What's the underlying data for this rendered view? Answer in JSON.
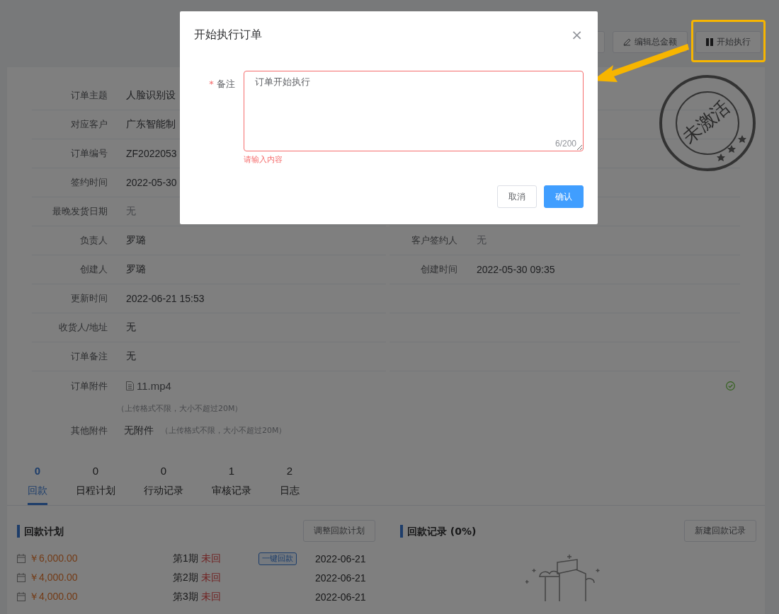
{
  "toolbar": {
    "buttons": [
      {
        "kind": "hidden"
      },
      {
        "kind": "edit",
        "label": "编辑总金额"
      },
      {
        "kind": "start",
        "label": "开始执行"
      }
    ]
  },
  "stamp": "未激活",
  "details": [
    {
      "label": "订单主题",
      "value": "人脸识别设",
      "muted": false
    },
    {
      "label": "对应客户",
      "value": "广东智能制",
      "muted": false
    },
    {
      "label": "订单编号",
      "value": "ZF2022053",
      "muted": false
    },
    {
      "label": "签约时间",
      "value": "2022-05-30",
      "muted": false
    },
    {
      "label": "最晚发货日期",
      "value": "无",
      "muted": true
    },
    {
      "label": "负责人",
      "value": "罗璐",
      "muted": false
    },
    {
      "label": "创建人",
      "value": "罗璐",
      "muted": false
    },
    {
      "label": "更新时间",
      "value": "2022-06-21 15:53",
      "muted": false
    },
    {
      "label": "收货人/地址",
      "value": "无",
      "muted": false
    },
    {
      "label": "订单备注",
      "value": "无",
      "muted": false
    }
  ],
  "right_details": [
    {
      "label": "客户签约人",
      "value": "无",
      "muted": true
    },
    {
      "label": "创建时间",
      "value": "2022-05-30 09:35",
      "muted": false
    }
  ],
  "attachment": {
    "label": "订单附件",
    "file": "11.mp4",
    "uploaded": true,
    "hint": "（上传格式不限，大小不超过20M）"
  },
  "other_attachment": {
    "label": "其他附件",
    "value": "无附件",
    "hint": "（上传格式不限，大小不超过20M）"
  },
  "tabs": [
    {
      "count": "0",
      "label": "回款",
      "selected": true
    },
    {
      "count": "0",
      "label": "日程计划",
      "selected": false
    },
    {
      "count": "0",
      "label": "行动记录",
      "selected": false
    },
    {
      "count": "1",
      "label": "审核记录",
      "selected": false
    },
    {
      "count": "2",
      "label": "日志",
      "selected": false
    }
  ],
  "payment_plan": {
    "title": "回款计划",
    "button": "调整回款计划",
    "rows": [
      {
        "amount": "￥6,000.00",
        "period": "第1期",
        "status": "未回",
        "action": "一键回款",
        "date": "2022-06-21"
      },
      {
        "amount": "￥4,000.00",
        "period": "第2期",
        "status": "未回",
        "date": "2022-06-21"
      },
      {
        "amount": "￥4,000.00",
        "period": "第3期",
        "status": "未回",
        "date": "2022-06-21"
      }
    ]
  },
  "payment_records": {
    "title": "回款记录 (0%)",
    "button": "新建回款记录"
  },
  "dialog": {
    "title": "开始执行订单",
    "close": "×",
    "field_label": "备注",
    "required_mark": "*",
    "value": "订单开始执行",
    "counter": "6/200",
    "error": "请输入内容",
    "buttons": [
      {
        "kind": "secondary",
        "label": "取消"
      },
      {
        "kind": "primary",
        "label": "确认"
      }
    ]
  }
}
